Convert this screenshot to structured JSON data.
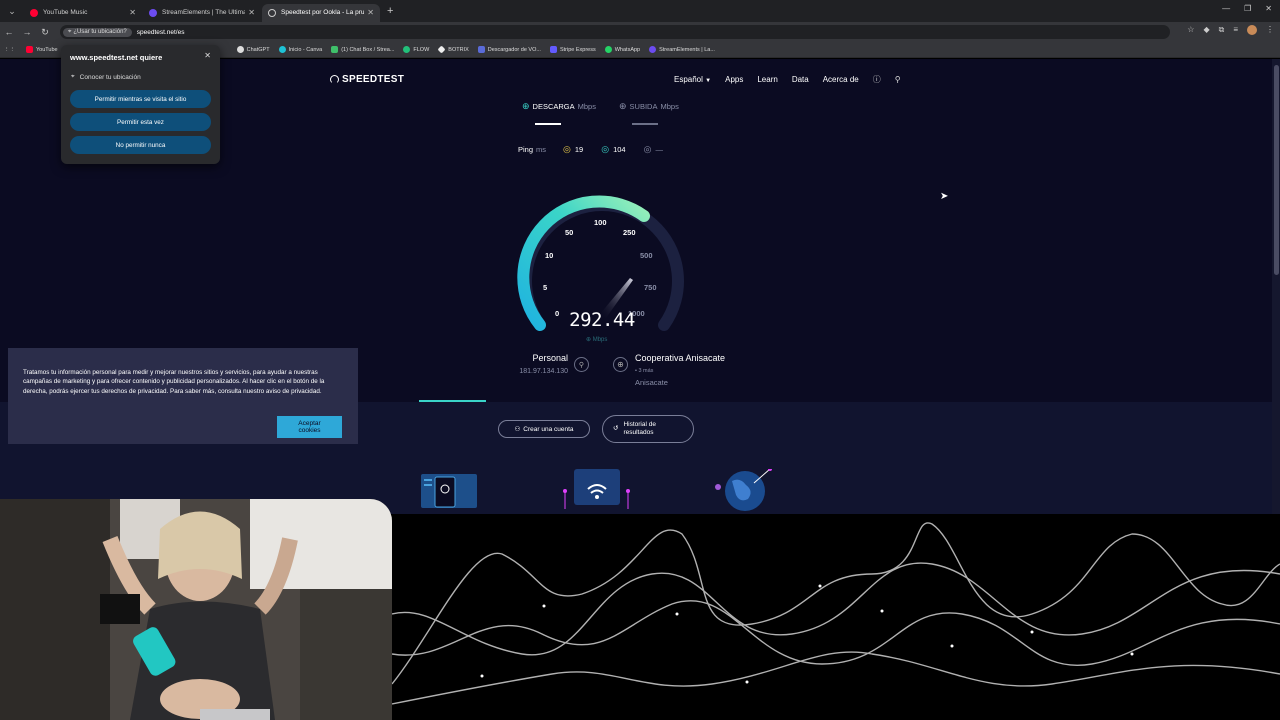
{
  "browser": {
    "tabs": [
      {
        "title": "YouTube Music",
        "favicon_color": "#ff0033"
      },
      {
        "title": "StreamElements | The Ultimate",
        "favicon_color": "#6c4cf0"
      },
      {
        "title": "Speedtest por Ookla - La prueb",
        "favicon_color": "#3b3b3b"
      }
    ],
    "location_chip": "¿Usar tu ubicación?",
    "url": "speedtest.net/es",
    "bookmarks": [
      {
        "label": "YouTube",
        "color": "#ff0033"
      },
      {
        "label": "ChatGPT",
        "color": "#dddddd"
      },
      {
        "label": "Inicio - Canva",
        "color": "#1ec2d6"
      },
      {
        "label": "(1) Chat Box / Strea...",
        "color": "#3fbf6a"
      },
      {
        "label": "FLOW",
        "color": "#22c07a"
      },
      {
        "label": "BOTRIX",
        "color": "#eeeeee"
      },
      {
        "label": "Descargador de VO...",
        "color": "#5a6bd8"
      },
      {
        "label": "Stripe Express",
        "color": "#635bff"
      },
      {
        "label": "WhatsApp",
        "color": "#25d366"
      },
      {
        "label": "StreamElements | La...",
        "color": "#6c4cf0"
      }
    ]
  },
  "location_popup": {
    "title": "www.speedtest.net quiere",
    "permission": "Conocer tu ubicación",
    "buttons": [
      "Permitir mientras se visita el sitio",
      "Permitir esta vez",
      "No permitir nunca"
    ]
  },
  "speedtest": {
    "brand": "SPEEDTEST",
    "nav": [
      "Español",
      "Apps",
      "Learn",
      "Data",
      "Acerca de"
    ],
    "download_label": "DESCARGA",
    "upload_label": "SUBIDA",
    "unit": "Mbps",
    "ping_label": "Ping",
    "ping_unit": "ms",
    "ping_values": [
      "19",
      "104",
      "—"
    ],
    "gauge_ticks": [
      "0",
      "5",
      "10",
      "50",
      "100",
      "250",
      "500",
      "750",
      "1000"
    ],
    "current_speed": "292.44",
    "speed_unit": "Mbps",
    "client_label": "Personal",
    "client_ip": "181.97.134.130",
    "server_name": "Cooperativa Anisacate",
    "server_more": "• 3 más",
    "server_location": "Anisacate",
    "create_account": "Crear una cuenta",
    "history_line1": "Historial de",
    "history_line2": "resultados"
  },
  "cookie_banner": {
    "text": "Tratamos tu información personal para medir y mejorar nuestros sitios y servicios, para ayudar a nuestras campañas de marketing y para ofrecer contenido y publicidad personalizados. Al hacer clic en el botón de la derecha, podrás ejercer tus derechos de privacidad. Para saber más, consulta nuestro aviso de privacidad.",
    "accept_line1": "Aceptar",
    "accept_line2": "cookies"
  },
  "colors": {
    "accent_teal": "#3ad4c8",
    "page_bg": "#0b0b22",
    "button_blue": "#0e4f7a"
  }
}
